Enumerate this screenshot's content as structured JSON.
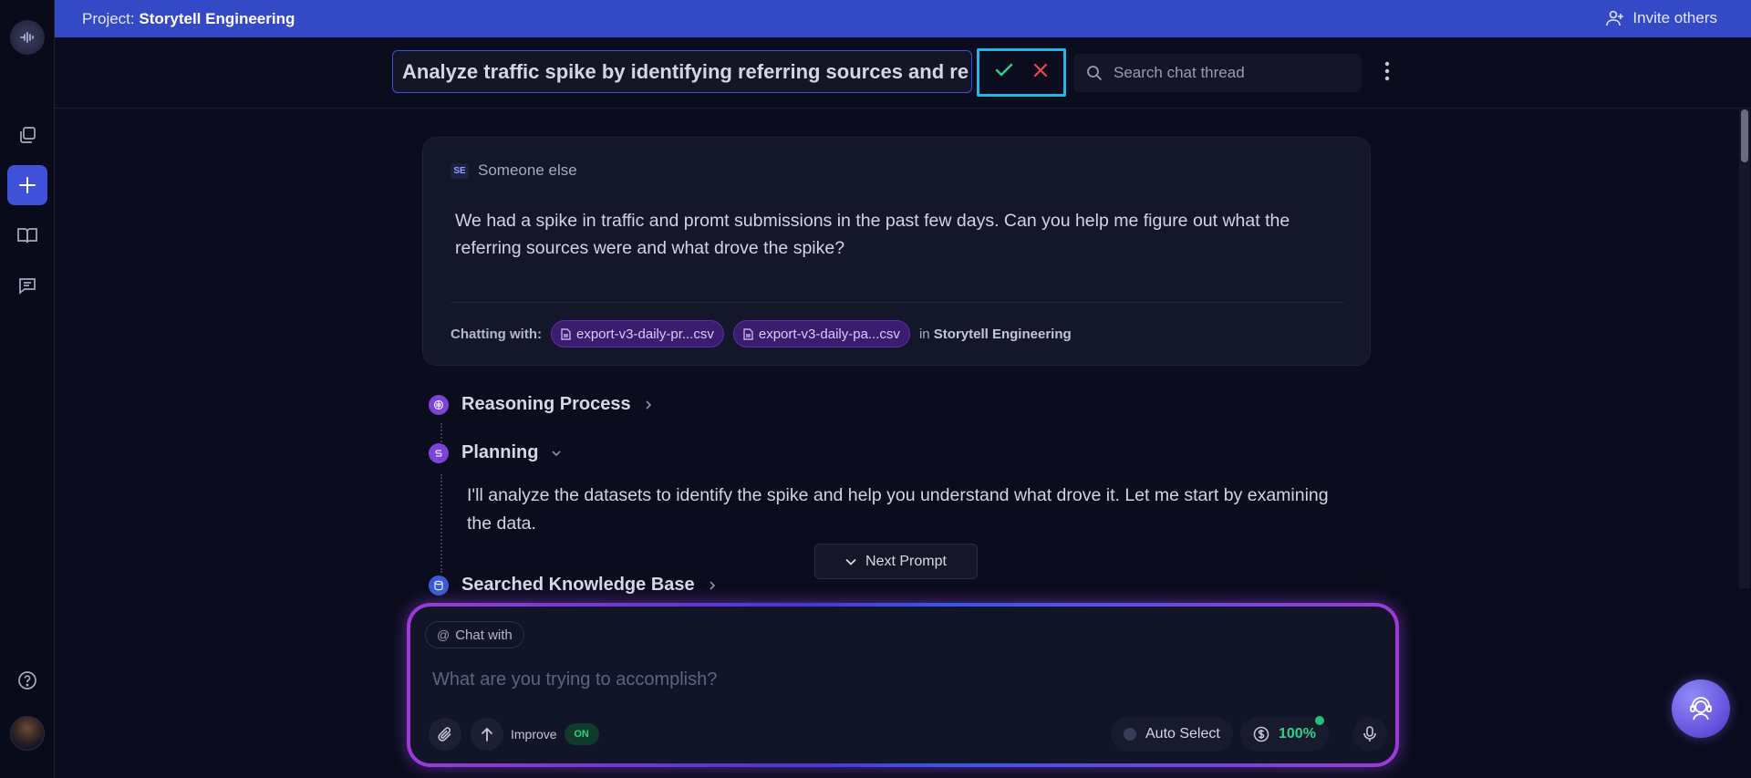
{
  "topbar": {
    "project_prefix": "Project:",
    "project_name": "Storytell Engineering",
    "invite_label": "Invite others"
  },
  "header": {
    "title_value": "Analyze traffic spike by identifying referring sources and re",
    "search_placeholder": "Search chat thread"
  },
  "message": {
    "author_initials": "SE",
    "author": "Someone else",
    "text": "We had a spike in traffic and promt submissions in the past few days. Can you help me figure out what the referring sources were and what drove the spike?",
    "chatting_label": "Chatting with:",
    "files": [
      "export-v3-daily-pr...csv",
      "export-v3-daily-pa...csv"
    ],
    "in_prefix": "in",
    "in_project": "Storytell Engineering"
  },
  "steps": {
    "reasoning": "Reasoning Process",
    "planning": "Planning",
    "planning_text": "I'll analyze the datasets to identify the spike and help you understand what drove it. Let me start by examining the data.",
    "searched": "Searched Knowledge Base"
  },
  "next_prompt_label": "Next Prompt",
  "composer": {
    "chat_with_label": "Chat with",
    "placeholder": "What are you trying to accomplish?",
    "improve_label": "Improve",
    "improve_state": "ON",
    "model_label": "Auto Select",
    "credits_value": "100%"
  },
  "colors": {
    "topbar": "#3449c6",
    "accent_cyan": "#1fb8e8",
    "confirm_green": "#2fd08a",
    "cancel_red": "#e5484d",
    "chip_purple": "#3a1d6e"
  }
}
